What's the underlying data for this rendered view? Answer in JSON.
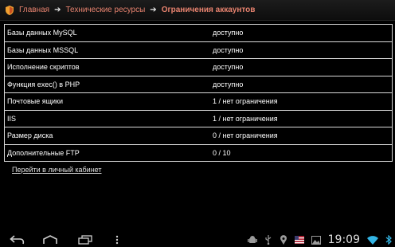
{
  "header": {
    "breadcrumbs": [
      {
        "label": "Главная"
      },
      {
        "label": "Технические ресурсы"
      },
      {
        "label": "Ограничения аккаунтов"
      }
    ],
    "logo_icon": "shield-logo-icon",
    "separator_icon": "arrow-right-icon"
  },
  "limits_table": {
    "rows": [
      {
        "name": "Базы данных MySQL",
        "value": "доступно"
      },
      {
        "name": "Базы данных MSSQL",
        "value": "доступно"
      },
      {
        "name": "Исполнение скриптов",
        "value": "доступно"
      },
      {
        "name": "Функция exec() в PHP",
        "value": "доступно"
      },
      {
        "name": "Почтовые ящики",
        "value": "1 / нет ограничения"
      },
      {
        "name": "IIS",
        "value": "1 / нет ограничения"
      },
      {
        "name": "Размер диска",
        "value": "0 / нет ограничения"
      },
      {
        "name": "Дополнительные FTP",
        "value": "0 / 10"
      }
    ]
  },
  "cabinet_link": "Перейти в личный кабинет",
  "system_bar": {
    "nav_icons": [
      "back-icon",
      "home-icon",
      "recent-apps-icon",
      "menu-icon"
    ],
    "status_icons": [
      "android-debug-icon",
      "usb-icon",
      "location-icon",
      "flag-icon",
      "image-icon",
      "wifi-icon",
      "bluetooth-icon"
    ],
    "clock": "19:09",
    "colors": {
      "accent": "#e8836f",
      "wifi": "#33b5e5"
    }
  }
}
